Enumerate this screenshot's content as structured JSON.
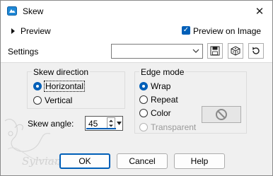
{
  "window": {
    "title": "Skew",
    "close_symbol": "✕"
  },
  "preview": {
    "label": "Preview",
    "checkbox_label": "Preview on Image",
    "checkbox_checked": true
  },
  "settings": {
    "label": "Settings",
    "combo_value": ""
  },
  "skew_direction": {
    "title": "Skew direction",
    "options": [
      {
        "label": "Horizontal",
        "selected": true
      },
      {
        "label": "Vertical",
        "selected": false
      }
    ]
  },
  "edge_mode": {
    "title": "Edge mode",
    "options": [
      {
        "label": "Wrap",
        "selected": true
      },
      {
        "label": "Repeat",
        "selected": false
      },
      {
        "label": "Color",
        "selected": false
      },
      {
        "label": "Transparent",
        "selected": false,
        "disabled": true
      }
    ]
  },
  "skew_angle": {
    "label": "Skew angle:",
    "value": "45"
  },
  "buttons": {
    "ok": "OK",
    "cancel": "Cancel",
    "help": "Help"
  },
  "watermark_text": "Sylviane",
  "colors": {
    "accent": "#005fb8",
    "dialog_bg": "#f0f0f0"
  }
}
